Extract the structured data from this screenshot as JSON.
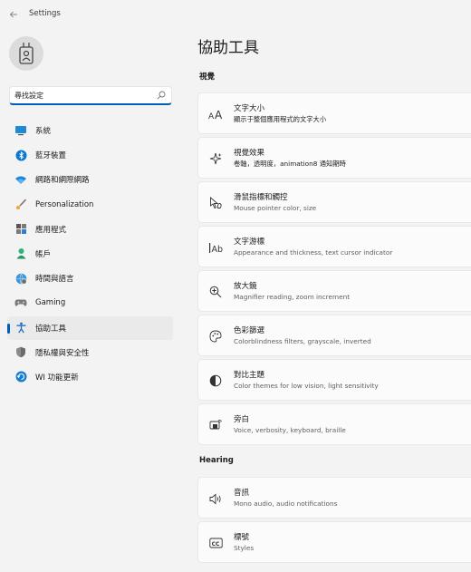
{
  "window": {
    "title": "Settings"
  },
  "search": {
    "text": "尋找設定"
  },
  "sidebar": {
    "items": [
      {
        "label": "系統",
        "icon": "monitor-icon",
        "active": false
      },
      {
        "label": "藍牙裝置",
        "icon": "bluetooth-icon",
        "active": false
      },
      {
        "label": "網路和網際網路",
        "icon": "wifi-icon",
        "active": false
      },
      {
        "label": "Personalization",
        "icon": "brush-icon",
        "active": false
      },
      {
        "label": "應用程式",
        "icon": "apps-icon",
        "active": false
      },
      {
        "label": "帳戶",
        "icon": "person-icon",
        "active": false
      },
      {
        "label": "時間與語言",
        "icon": "globe-clock-icon",
        "active": false
      },
      {
        "label": "Gaming",
        "icon": "gamepad-icon",
        "active": false
      },
      {
        "label": "協助工具",
        "icon": "accessibility-icon",
        "active": true
      },
      {
        "label": "隱私權與安全性",
        "icon": "shield-icon",
        "active": false
      },
      {
        "label": "WI 功能更新",
        "icon": "update-icon",
        "active": false
      }
    ]
  },
  "main": {
    "title": "協助工具",
    "sections": [
      {
        "title": "視覺",
        "cards": [
          {
            "title": "文字大小",
            "subtitle": "顯示于整個應用程式的文字大小",
            "icon": "text-size-icon"
          },
          {
            "title": "視覺效果",
            "subtitle": "卷軸，透明度，animation8 通知期時",
            "icon": "sparkle-icon"
          },
          {
            "title": "滑鼠指標和觸控",
            "subtitle": "Mouse pointer color, size",
            "icon": "pointer-icon"
          },
          {
            "title": "文字游標",
            "subtitle": "Appearance and thickness, text cursor indicator",
            "icon": "text-cursor-icon"
          },
          {
            "title": "放大鏡",
            "subtitle": "Magnifier reading, zoom increment",
            "icon": "magnifier-icon"
          },
          {
            "title": "色彩篩選",
            "subtitle": "Colorblindness filters, grayscale, inverted",
            "icon": "palette-icon"
          },
          {
            "title": "對比主題",
            "subtitle": "Color themes for low vision, light sensitivity",
            "icon": "contrast-icon"
          },
          {
            "title": "旁白",
            "subtitle": "Voice, verbosity, keyboard, braille",
            "icon": "narrator-icon"
          }
        ]
      },
      {
        "title": "Hearing",
        "cards": [
          {
            "title": "音訊",
            "subtitle": "Mono audio, audio notifications",
            "icon": "speaker-icon"
          },
          {
            "title": "標號",
            "subtitle": "Styles",
            "icon": "captions-icon"
          }
        ]
      }
    ]
  },
  "colors": {
    "accent": "#005fb8",
    "background": "#f3f3f3",
    "card": "#fbfbfb"
  }
}
